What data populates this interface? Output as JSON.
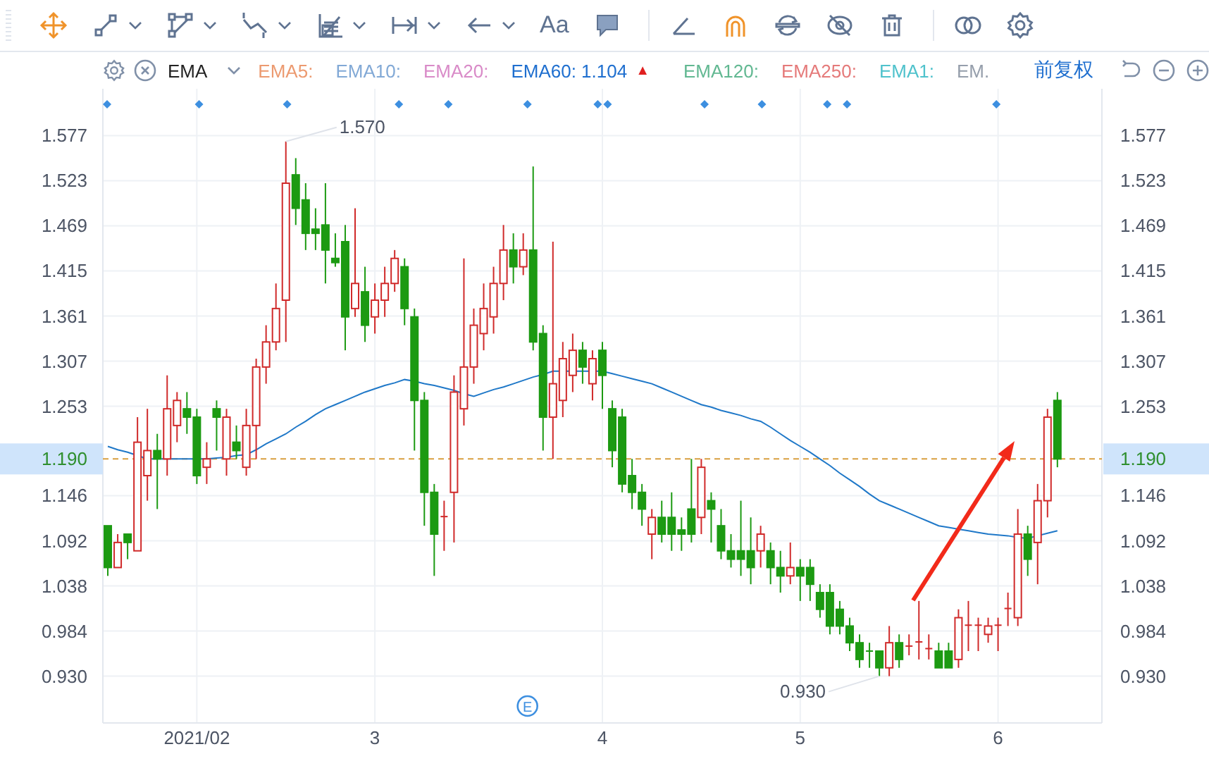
{
  "toolbar": {
    "items": [
      {
        "kind": "move",
        "active": true,
        "dropdown": false
      },
      {
        "kind": "segment",
        "active": false,
        "dropdown": true
      },
      {
        "kind": "polygon",
        "active": false,
        "dropdown": true
      },
      {
        "kind": "wave",
        "active": false,
        "dropdown": true
      },
      {
        "kind": "pattern",
        "active": false,
        "dropdown": true
      },
      {
        "kind": "measure",
        "active": false,
        "dropdown": true
      },
      {
        "kind": "arrow",
        "active": false,
        "dropdown": true
      },
      {
        "kind": "text",
        "label": "Aa",
        "active": false,
        "dropdown": false
      },
      {
        "kind": "comment",
        "active": false,
        "dropdown": false
      },
      {
        "kind": "separator"
      },
      {
        "kind": "angle",
        "active": false,
        "dropdown": false
      },
      {
        "kind": "magnet",
        "active": true,
        "dropdown": false
      },
      {
        "kind": "sync",
        "active": false,
        "dropdown": false
      },
      {
        "kind": "hide",
        "active": false,
        "dropdown": false
      },
      {
        "kind": "trash",
        "active": false,
        "dropdown": false
      },
      {
        "kind": "separator"
      },
      {
        "kind": "rings",
        "active": false,
        "dropdown": false
      },
      {
        "kind": "settings",
        "active": false,
        "dropdown": false
      }
    ]
  },
  "indicator": {
    "name": "EMA",
    "items": [
      {
        "label": "EMA5:",
        "color": "#ec9a70"
      },
      {
        "label": "EMA10:",
        "color": "#82a9d6"
      },
      {
        "label": "EMA20:",
        "color": "#d98bc8"
      },
      {
        "label": "EMA60:",
        "value": "1.104",
        "trend": "▲",
        "color": "#1f6fcf"
      },
      {
        "label": "EMA120:",
        "color": "#62b892"
      },
      {
        "label": "EMA250:",
        "color": "#e57a7a"
      },
      {
        "label": "EMA1:",
        "color": "#4fc2cc"
      },
      {
        "label": "EM.",
        "color": "#959eab"
      }
    ],
    "adjust": "前复权"
  },
  "chart": {
    "right_axis": [
      "1.577",
      "1.523",
      "1.469",
      "1.415",
      "1.361",
      "1.307",
      "1.253",
      "1.146",
      "1.092",
      "1.038",
      "0.984",
      "0.930"
    ],
    "high_label": "1.570",
    "low_label": "0.930",
    "current_price": {
      "right_label": "1.190"
    },
    "arrow": {
      "color": "#f22a1a"
    },
    "event_marker": {
      "label": "E"
    },
    "chart_data": {
      "type": "candlestick",
      "categories": [
        null,
        null,
        null,
        null,
        null,
        null,
        null,
        null,
        null,
        "2021/02",
        null,
        null,
        null,
        null,
        null,
        null,
        null,
        null,
        null,
        null,
        null,
        null,
        null,
        null,
        null,
        null,
        null,
        "3",
        null,
        null,
        null,
        null,
        null,
        null,
        null,
        null,
        null,
        null,
        null,
        null,
        null,
        null,
        null,
        null,
        null,
        null,
        null,
        null,
        null,
        null,
        "4",
        null,
        null,
        null,
        null,
        null,
        null,
        null,
        null,
        null,
        null,
        null,
        null,
        null,
        null,
        null,
        null,
        null,
        null,
        null,
        "5",
        null,
        null,
        null,
        null,
        null,
        null,
        null,
        null,
        null,
        null,
        null,
        null,
        null,
        null,
        null,
        null,
        null,
        null,
        null,
        "6",
        null,
        null,
        null,
        null,
        null,
        null,
        null,
        null,
        null,
        null
      ],
      "grid": true,
      "ylim": [
        0.874,
        1.633
      ],
      "ref_lines": [
        {
          "axis": "y",
          "value": 1.19,
          "label": "1.190",
          "color": "#d9a040"
        }
      ],
      "yticks": [
        1.577,
        1.523,
        1.469,
        1.415,
        1.361,
        1.307,
        1.253,
        1.146,
        1.092,
        1.038,
        0.984,
        {
          "value": 0.93,
          "label": "0.930"
        }
      ],
      "series": [
        {
          "type": "line",
          "color": "#1f78c8",
          "values": [
            1.205,
            1.201,
            1.198,
            1.194,
            1.19,
            1.19,
            1.19,
            1.19,
            1.19,
            1.19,
            1.19,
            1.191,
            1.192,
            1.194,
            1.195,
            1.201,
            1.208,
            1.214,
            1.22,
            1.228,
            1.235,
            1.243,
            1.25,
            1.255,
            1.26,
            1.265,
            1.27,
            1.274,
            1.278,
            1.281,
            1.285,
            1.283,
            1.28,
            1.278,
            1.275,
            1.272,
            1.268,
            1.265,
            1.269,
            1.273,
            1.276,
            1.28,
            1.284,
            1.288,
            1.291,
            1.295,
            1.295,
            1.295,
            1.295,
            1.295,
            1.295,
            1.292,
            1.289,
            1.286,
            1.283,
            1.28,
            1.275,
            1.27,
            1.265,
            1.26,
            1.255,
            1.252,
            1.248,
            1.245,
            1.242,
            1.238,
            1.235,
            1.228,
            1.22,
            1.212,
            1.205,
            1.198,
            1.19,
            1.182,
            1.173,
            1.165,
            1.157,
            1.148,
            1.14,
            1.135,
            1.13,
            1.125,
            1.12,
            1.115,
            1.11,
            1.108,
            1.106,
            1.104,
            1.102,
            1.1,
            1.099,
            1.098,
            1.096,
            1.095,
            1.098,
            1.101,
            1.104,
            null,
            null,
            null,
            null
          ]
        }
      ],
      "ohlc": [
        [
          1.11,
          1.11,
          1.05,
          1.06
        ],
        [
          1.06,
          1.1,
          1.06,
          1.09
        ],
        [
          1.1,
          1.1,
          1.07,
          1.09
        ],
        [
          1.08,
          1.24,
          1.08,
          1.21
        ],
        [
          1.17,
          1.25,
          1.14,
          1.2
        ],
        [
          1.2,
          1.22,
          1.13,
          1.19
        ],
        [
          1.19,
          1.29,
          1.17,
          1.25
        ],
        [
          1.23,
          1.27,
          1.21,
          1.26
        ],
        [
          1.25,
          1.27,
          1.22,
          1.24
        ],
        [
          1.24,
          1.25,
          1.16,
          1.17
        ],
        [
          1.18,
          1.21,
          1.16,
          1.19
        ],
        [
          1.25,
          1.26,
          1.2,
          1.24
        ],
        [
          1.19,
          1.25,
          1.17,
          1.24
        ],
        [
          1.21,
          1.23,
          1.19,
          1.2
        ],
        [
          1.18,
          1.25,
          1.17,
          1.23
        ],
        [
          1.23,
          1.31,
          1.19,
          1.3
        ],
        [
          1.3,
          1.35,
          1.28,
          1.33
        ],
        [
          1.33,
          1.4,
          1.32,
          1.37
        ],
        [
          1.38,
          1.57,
          1.33,
          1.52
        ],
        [
          1.53,
          1.55,
          1.47,
          1.49
        ],
        [
          1.5,
          1.52,
          1.44,
          1.46
        ],
        [
          1.465,
          1.49,
          1.44,
          1.46
        ],
        [
          1.47,
          1.52,
          1.4,
          1.44
        ],
        [
          1.43,
          1.46,
          1.42,
          1.425
        ],
        [
          1.45,
          1.47,
          1.32,
          1.36
        ],
        [
          1.37,
          1.49,
          1.36,
          1.4
        ],
        [
          1.39,
          1.42,
          1.33,
          1.35
        ],
        [
          1.36,
          1.4,
          1.34,
          1.38
        ],
        [
          1.38,
          1.42,
          1.36,
          1.4
        ],
        [
          1.4,
          1.44,
          1.39,
          1.43
        ],
        [
          1.42,
          1.43,
          1.35,
          1.37
        ],
        [
          1.36,
          1.37,
          1.2,
          1.26
        ],
        [
          1.26,
          1.27,
          1.11,
          1.15
        ],
        [
          1.15,
          1.16,
          1.05,
          1.1
        ],
        [
          1.12,
          1.14,
          1.08,
          1.121
        ],
        [
          1.15,
          1.29,
          1.09,
          1.27
        ],
        [
          1.25,
          1.43,
          1.23,
          1.3
        ],
        [
          1.3,
          1.37,
          1.28,
          1.35
        ],
        [
          1.34,
          1.4,
          1.32,
          1.37
        ],
        [
          1.36,
          1.42,
          1.34,
          1.4
        ],
        [
          1.4,
          1.47,
          1.38,
          1.44
        ],
        [
          1.44,
          1.46,
          1.4,
          1.42
        ],
        [
          1.42,
          1.46,
          1.41,
          1.44
        ],
        [
          1.44,
          1.54,
          1.32,
          1.33
        ],
        [
          1.34,
          1.35,
          1.2,
          1.24
        ],
        [
          1.24,
          1.45,
          1.19,
          1.28
        ],
        [
          1.26,
          1.33,
          1.24,
          1.31
        ],
        [
          1.29,
          1.34,
          1.27,
          1.32
        ],
        [
          1.32,
          1.33,
          1.28,
          1.3
        ],
        [
          1.28,
          1.32,
          1.26,
          1.31
        ],
        [
          1.32,
          1.33,
          1.25,
          1.29
        ],
        [
          1.25,
          1.26,
          1.18,
          1.2
        ],
        [
          1.24,
          1.25,
          1.15,
          1.16
        ],
        [
          1.17,
          1.19,
          1.13,
          1.15
        ],
        [
          1.15,
          1.16,
          1.11,
          1.13
        ],
        [
          1.1,
          1.13,
          1.07,
          1.12
        ],
        [
          1.12,
          1.14,
          1.09,
          1.1
        ],
        [
          1.12,
          1.15,
          1.08,
          1.1
        ],
        [
          1.105,
          1.12,
          1.08,
          1.1
        ],
        [
          1.13,
          1.19,
          1.09,
          1.1
        ],
        [
          1.12,
          1.19,
          1.1,
          1.18
        ],
        [
          1.14,
          1.15,
          1.09,
          1.13
        ],
        [
          1.11,
          1.13,
          1.07,
          1.08
        ],
        [
          1.08,
          1.1,
          1.06,
          1.07
        ],
        [
          1.08,
          1.14,
          1.05,
          1.07
        ],
        [
          1.08,
          1.12,
          1.04,
          1.06
        ],
        [
          1.08,
          1.11,
          1.06,
          1.1
        ],
        [
          1.08,
          1.09,
          1.04,
          1.06
        ],
        [
          1.06,
          1.08,
          1.03,
          1.05
        ],
        [
          1.05,
          1.09,
          1.04,
          1.06
        ],
        [
          1.06,
          1.07,
          1.02,
          1.05
        ],
        [
          1.06,
          1.07,
          1.02,
          1.04
        ],
        [
          1.03,
          1.04,
          1.0,
          1.01
        ],
        [
          1.03,
          1.04,
          0.98,
          0.99
        ],
        [
          1.01,
          1.02,
          0.98,
          0.99
        ],
        [
          0.99,
          1.0,
          0.96,
          0.97
        ],
        [
          0.97,
          0.98,
          0.94,
          0.95
        ],
        [
          0.96,
          0.97,
          0.94,
          0.958
        ],
        [
          0.96,
          0.96,
          0.93,
          0.94
        ],
        [
          0.94,
          0.99,
          0.93,
          0.97
        ],
        [
          0.97,
          0.98,
          0.94,
          0.95
        ],
        [
          0.965,
          0.98,
          0.955,
          0.966
        ],
        [
          0.97,
          1.02,
          0.95,
          0.971
        ],
        [
          0.962,
          0.98,
          0.95,
          0.963
        ],
        [
          0.96,
          0.97,
          0.94,
          0.94
        ],
        [
          0.96,
          0.97,
          0.94,
          0.94
        ],
        [
          0.95,
          1.01,
          0.94,
          1.0
        ],
        [
          0.99,
          1.02,
          0.96,
          0.991
        ],
        [
          0.99,
          1.0,
          0.96,
          0.991
        ],
        [
          0.98,
          1.0,
          0.97,
          0.99
        ],
        [
          0.99,
          1.0,
          0.96,
          0.991
        ],
        [
          1.01,
          1.03,
          0.99,
          1.011
        ],
        [
          1.0,
          1.13,
          0.99,
          1.1
        ],
        [
          1.1,
          1.11,
          1.05,
          1.07
        ],
        [
          1.09,
          1.16,
          1.04,
          1.14
        ],
        [
          1.14,
          1.25,
          1.12,
          1.24
        ],
        [
          1.26,
          1.27,
          1.18,
          1.19
        ],
        null,
        null,
        null,
        null
      ]
    }
  }
}
